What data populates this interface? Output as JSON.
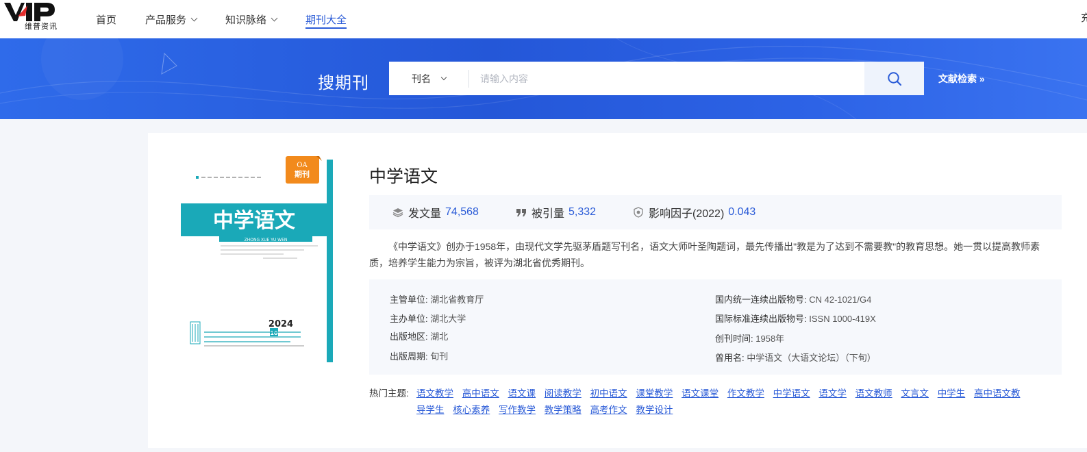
{
  "header": {
    "logo_mark": "VIP",
    "logo_text": "维普资讯",
    "nav": [
      {
        "label": "首页"
      },
      {
        "label": "产品服务"
      },
      {
        "label": "知识脉络"
      },
      {
        "label": "期刊大全"
      }
    ],
    "edge_text": "充"
  },
  "search": {
    "title": "搜期刊",
    "field": "刊名",
    "placeholder": "请输入内容",
    "advanced_label": "文献检索 »"
  },
  "journal": {
    "cover": {
      "badge_top": "OA",
      "badge_bottom": "期刊",
      "title": "中学语文",
      "pinyin": "ZHONG XUE YU WEN",
      "year": "2024",
      "issue": "10"
    },
    "title": "中学语文",
    "stats": {
      "articles_label": "发文量",
      "articles_value": "74,568",
      "citations_label": "被引量",
      "citations_value": "5,332",
      "impact_label": "影响因子(2022)",
      "impact_value": "0.043"
    },
    "description": "《中学语文》创办于1958年，由现代文学先驱茅盾题写刊名，语文大师叶圣陶题词，最先传播出\"教是为了达到不需要教\"的教育思想。她一贯以提高教师素质，培养学生能力为宗旨，被评为湖北省优秀期刊。",
    "info_left": [
      {
        "label": "主管单位:",
        "value": "湖北省教育厅"
      },
      {
        "label": "主办单位:",
        "value": "湖北大学"
      },
      {
        "label": "出版地区:",
        "value": "湖北"
      },
      {
        "label": "出版周期:",
        "value": "旬刊"
      }
    ],
    "info_right": [
      {
        "label": "国内统一连续出版物号:",
        "value": "CN 42-1021/G4"
      },
      {
        "label": "国际标准连续出版物号:",
        "value": "ISSN 1000-419X"
      },
      {
        "label": "创刊时间:",
        "value": "1958年"
      },
      {
        "label": "曾用名:",
        "value": "中学语文（大语文论坛）（下旬）"
      }
    ],
    "topics_label": "热门主题:",
    "topics": [
      "语文教学",
      "高中语文",
      "语文课",
      "阅读教学",
      "初中语文",
      "课堂教学",
      "语文课堂",
      "作文教学",
      "中学语文",
      "语文学",
      "语文教师",
      "文言文",
      "中学生",
      "高中语文教",
      "导学生",
      "核心素养",
      "写作教学",
      "教学策略",
      "高考作文",
      "教学设计"
    ]
  },
  "colors": {
    "accent": "#2a5bd7",
    "banner": "#2457d8",
    "cover_teal": "#1aa9b8",
    "badge_orange": "#f28a1c"
  }
}
